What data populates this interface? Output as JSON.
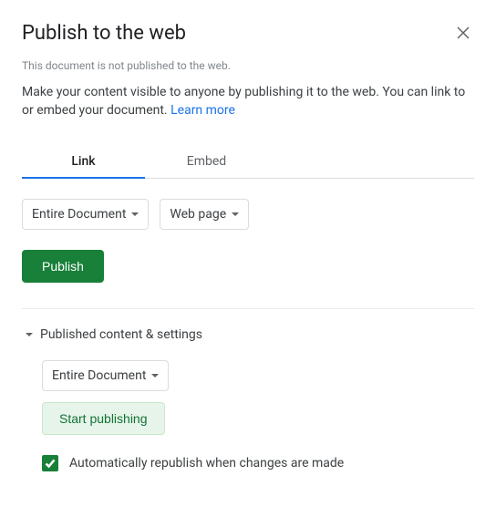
{
  "dialog": {
    "title": "Publish to the web",
    "status": "This document is not published to the web.",
    "description": "Make your content visible to anyone by publishing it to the web. You can link to or embed your document. ",
    "learn_more": "Learn more"
  },
  "tabs": {
    "link": "Link",
    "embed": "Embed",
    "active": "link"
  },
  "dropdowns": {
    "scope": "Entire Document",
    "format": "Web page"
  },
  "buttons": {
    "publish": "Publish",
    "start_publishing": "Start publishing"
  },
  "section": {
    "title": "Published content & settings",
    "dropdown_scope": "Entire Document",
    "checkbox_label": "Automatically republish when changes are made",
    "checkbox_checked": true
  }
}
